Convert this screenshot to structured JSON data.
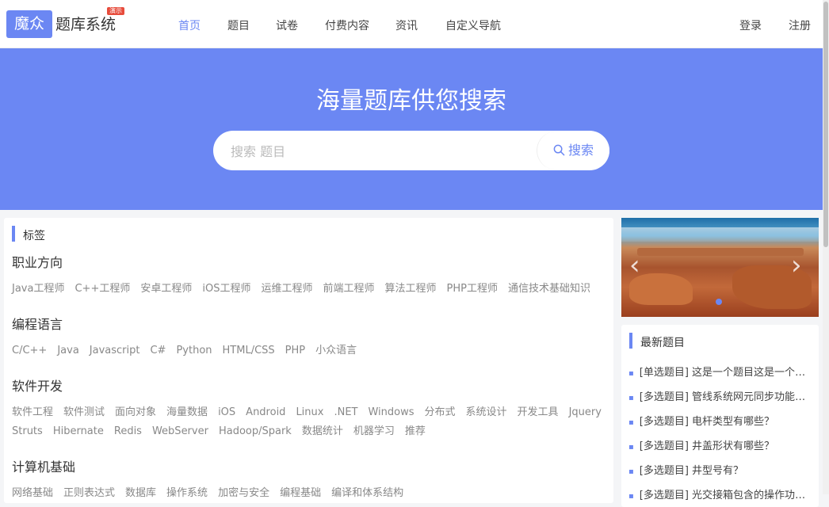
{
  "header": {
    "logo_text": "魔众",
    "title": "题库系统",
    "badge": "演示",
    "nav": [
      {
        "label": "首页",
        "active": true
      },
      {
        "label": "题目"
      },
      {
        "label": "试卷"
      },
      {
        "label": "付费内容"
      },
      {
        "label": "资讯"
      },
      {
        "label": "自定义导航"
      }
    ],
    "login": "登录",
    "register": "注册"
  },
  "hero": {
    "title": "海量题库供您搜索",
    "search_placeholder": "搜索 题目",
    "search_button": "搜索"
  },
  "tags_section": {
    "title": "标签",
    "categories": [
      {
        "name": "职业方向",
        "lines": [
          [
            "Java工程师",
            "C++工程师",
            "安卓工程师",
            "iOS工程师",
            "运维工程师",
            "前端工程师",
            "算法工程师",
            "PHP工程师",
            "通信技术基础知识"
          ]
        ]
      },
      {
        "name": "编程语言",
        "lines": [
          [
            "C/C++",
            "Java",
            "Javascript",
            "C#",
            "Python",
            "HTML/CSS",
            "PHP",
            "小众语言"
          ]
        ]
      },
      {
        "name": "软件开发",
        "lines": [
          [
            "软件工程",
            "软件测试",
            "面向对象",
            "海量数据",
            "iOS",
            "Android",
            "Linux",
            ".NET",
            "Windows",
            "分布式",
            "系统设计",
            "开发工具",
            "Jquery"
          ],
          [
            "Struts",
            "Hibernate",
            "Redis",
            "WebServer",
            "Hadoop/Spark",
            "数据统计",
            "机器学习",
            "推荐"
          ]
        ]
      },
      {
        "name": "计算机基础",
        "lines": [
          [
            "网络基础",
            "正则表达式",
            "数据库",
            "操作系统",
            "加密与安全",
            "编程基础",
            "编译和体系结构"
          ]
        ]
      }
    ]
  },
  "latest": {
    "title": "最新题目",
    "items": [
      "[单选题目] 这是一个题目这是一个题目这是一个题目",
      "[多选题目] 管线系统网元同步功能有哪些？",
      "[多选题目] 电杆类型有哪些？",
      "[多选题目] 井盖形状有哪些？",
      "[多选题目] 井型号有？",
      "[多选题目] 光交接箱包含的操作功能有哪些？"
    ]
  },
  "carousel": {
    "prev": "‹",
    "next": "›",
    "active_slide": 1
  },
  "colors": {
    "accent": "#6b87f3"
  }
}
